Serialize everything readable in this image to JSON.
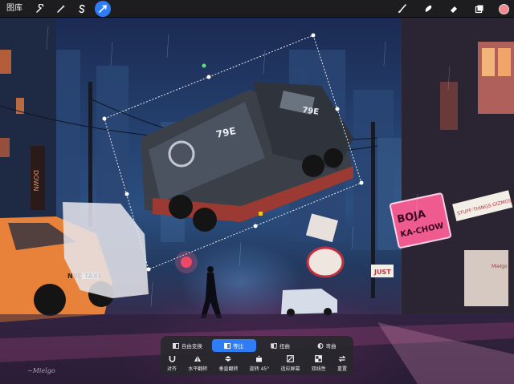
{
  "toolbar": {
    "gallery_label": "图库",
    "left_tools": [
      {
        "icon": "wrench-icon",
        "name": "actions"
      },
      {
        "icon": "magic-wand-icon",
        "name": "adjustments"
      },
      {
        "icon": "selection-s-icon",
        "name": "selection"
      },
      {
        "icon": "arrow-cursor-icon",
        "name": "transform",
        "active": true
      }
    ],
    "right_tools": [
      {
        "icon": "brush-icon",
        "name": "paint"
      },
      {
        "icon": "smudge-icon",
        "name": "smudge"
      },
      {
        "icon": "eraser-icon",
        "name": "erase"
      },
      {
        "icon": "layers-icon",
        "name": "layers"
      }
    ],
    "current_color": "#f08a8f",
    "accent": "#2e7cf6"
  },
  "transform_panel": {
    "modes": [
      {
        "label": "自由变换",
        "icon": "free-transform-icon",
        "active": false
      },
      {
        "label": "等比",
        "icon": "uniform-icon",
        "active": true
      },
      {
        "label": "扭曲",
        "icon": "distort-icon",
        "active": false
      },
      {
        "label": "弯曲",
        "icon": "warp-icon",
        "active": false
      }
    ],
    "actions": [
      {
        "label": "对齐",
        "icon": "magnet-icon"
      },
      {
        "label": "水平翻转",
        "icon": "flip-horizontal-icon"
      },
      {
        "label": "垂直翻转",
        "icon": "flip-vertical-icon"
      },
      {
        "label": "旋转 45°",
        "icon": "rotate-icon"
      },
      {
        "label": "适应屏幕",
        "icon": "fit-screen-icon"
      },
      {
        "label": "双线性",
        "icon": "bilinear-icon"
      },
      {
        "label": "重置",
        "icon": "reset-icon"
      }
    ]
  },
  "artwork": {
    "truck_number": "79E",
    "signs": {
      "boja_1": "BOJA",
      "boja_2": "KA-CHOW",
      "stuff": "STUFF·THINGS·GIZMOS",
      "down": "DOWN",
      "just": "JUST",
      "taxi": "NYC TAXI",
      "mielgo": "Mielgo"
    }
  }
}
